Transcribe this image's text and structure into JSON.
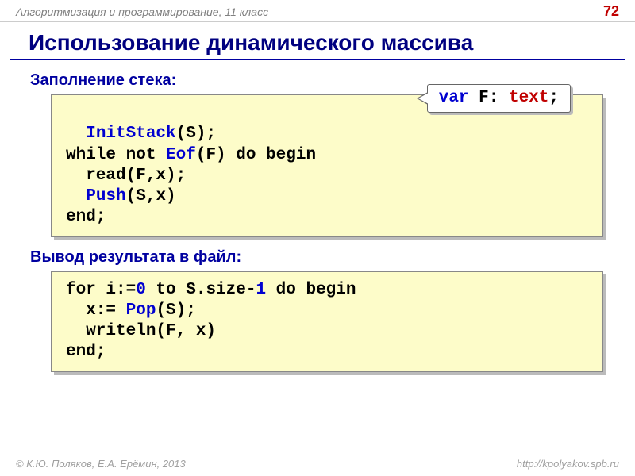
{
  "header": {
    "course": "Алгоритмизация и программирование, 11 класс",
    "page": "72"
  },
  "title": "Использование динамического массива",
  "section1": {
    "label": "Заполнение стека:",
    "callout": {
      "kw_var": "var",
      "ident": " F",
      "colon": ": ",
      "type": "text",
      "semi": ";"
    },
    "code": {
      "l1_fn": "InitStack",
      "l1_rest": "(S);",
      "l2_a": "while not ",
      "l2_fn": "Eof",
      "l2_b": "(F) do begin",
      "l3": "  read(F,x);",
      "l4_pad": "  ",
      "l4_fn": "Push",
      "l4_rest": "(S,x)",
      "l5": "end;"
    }
  },
  "section2": {
    "label": "Вывод результата в файл:",
    "code": {
      "l1_a": "for i:=",
      "l1_zero": "0",
      "l1_b": " to S.size-",
      "l1_one": "1",
      "l1_c": " do begin",
      "l2_a": "  x:= ",
      "l2_fn": "Pop",
      "l2_b": "(S);",
      "l3": "  writeln(F, x)",
      "l4": "end;"
    }
  },
  "footer": {
    "authors": "© К.Ю. Поляков, Е.А. Ерёмин, 2013",
    "url": "http://kpolyakov.spb.ru"
  }
}
